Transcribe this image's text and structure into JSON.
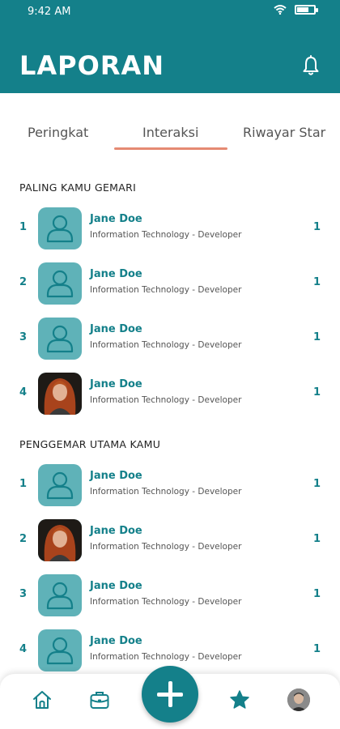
{
  "status_bar": {
    "time": "9:42 AM",
    "battery_level": 0.7
  },
  "header": {
    "title": "LAPORAN",
    "notification_icon": "bell-icon"
  },
  "tabs": [
    {
      "label": "Peringkat",
      "active": false
    },
    {
      "label": "Interaksi",
      "active": true
    },
    {
      "label": "Riwayar Star",
      "active": false
    }
  ],
  "colors": {
    "primary": "#14808a",
    "avatar_bg": "#5fb2b8",
    "tab_indicator": "#e58a73"
  },
  "sections": [
    {
      "title": "PALING KAMU GEMARI",
      "items": [
        {
          "rank": "1",
          "name": "Jane Doe",
          "role": "Information Technology - Developer",
          "score": "1",
          "avatar": "user-icon"
        },
        {
          "rank": "2",
          "name": "Jane Doe",
          "role": "Information Technology - Developer",
          "score": "1",
          "avatar": "user-icon"
        },
        {
          "rank": "3",
          "name": "Jane Doe",
          "role": "Information Technology - Developer",
          "score": "1",
          "avatar": "user-icon"
        },
        {
          "rank": "4",
          "name": "Jane Doe",
          "role": "Information Technology - Developer",
          "score": "1",
          "avatar": "photo"
        }
      ]
    },
    {
      "title": "PENGGEMAR UTAMA KAMU",
      "items": [
        {
          "rank": "1",
          "name": "Jane Doe",
          "role": "Information Technology - Developer",
          "score": "1",
          "avatar": "user-icon"
        },
        {
          "rank": "2",
          "name": "Jane Doe",
          "role": "Information Technology - Developer",
          "score": "1",
          "avatar": "photo"
        },
        {
          "rank": "3",
          "name": "Jane Doe",
          "role": "Information Technology - Developer",
          "score": "1",
          "avatar": "user-icon"
        },
        {
          "rank": "4",
          "name": "Jane Doe",
          "role": "Information Technology - Developer",
          "score": "1",
          "avatar": "user-icon"
        }
      ]
    }
  ],
  "bottom_nav": [
    {
      "icon": "home-icon"
    },
    {
      "icon": "briefcase-icon"
    },
    {
      "icon": "plus-icon"
    },
    {
      "icon": "star-icon"
    },
    {
      "icon": "profile-avatar"
    }
  ]
}
